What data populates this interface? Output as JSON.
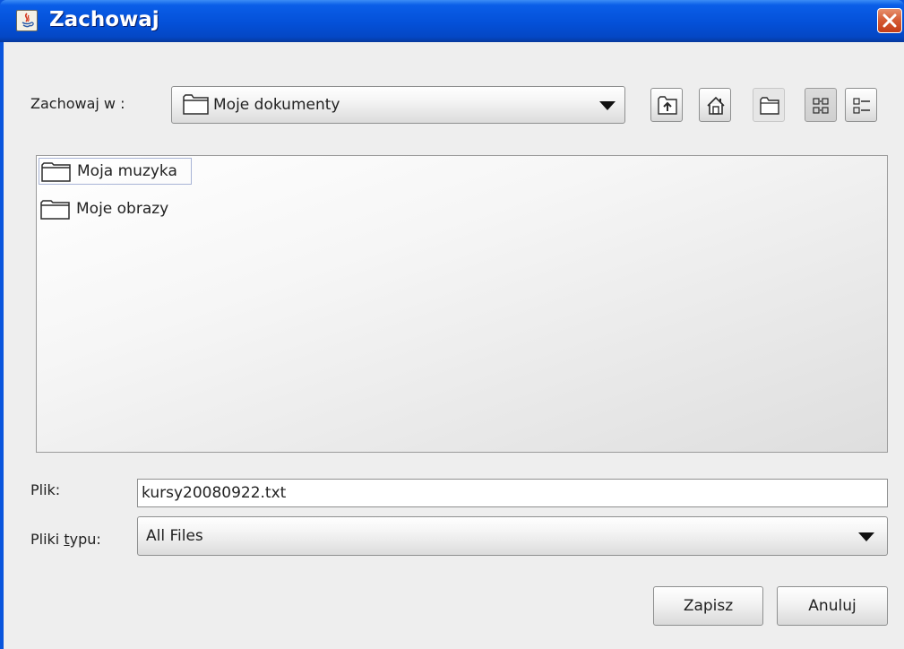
{
  "window": {
    "title": "Zachowaj",
    "app_icon": "java-icon",
    "close_icon": "close-icon"
  },
  "look_in": {
    "label": "Zachowaj w :",
    "value": "Moje dokumenty",
    "icon": "folder-icon"
  },
  "toolbar": {
    "buttons": [
      {
        "name": "up-one-level",
        "icon": "folder-up-icon"
      },
      {
        "name": "home",
        "icon": "home-icon"
      },
      {
        "name": "new-folder",
        "icon": "new-folder-icon"
      },
      {
        "name": "list-view",
        "icon": "list-view-icon",
        "selected": true
      },
      {
        "name": "details-view",
        "icon": "details-view-icon",
        "selected": false
      }
    ]
  },
  "files": [
    {
      "name": "Moja muzyka",
      "icon": "folder-icon",
      "selected": true
    },
    {
      "name": "Moje obrazy",
      "icon": "folder-icon",
      "selected": false
    }
  ],
  "file_name": {
    "label": "Plik:",
    "value": "kursy20080922.txt"
  },
  "file_type": {
    "label_before": "Pliki ",
    "label_mnemonic": "t",
    "label_after": "ypu:",
    "value": "All Files"
  },
  "buttons": {
    "save": "Zapisz",
    "cancel": "Anuluj"
  },
  "colors": {
    "title_bar": "#0450d8",
    "close_button": "#d45a33",
    "dialog_background": "#eeeeee"
  }
}
